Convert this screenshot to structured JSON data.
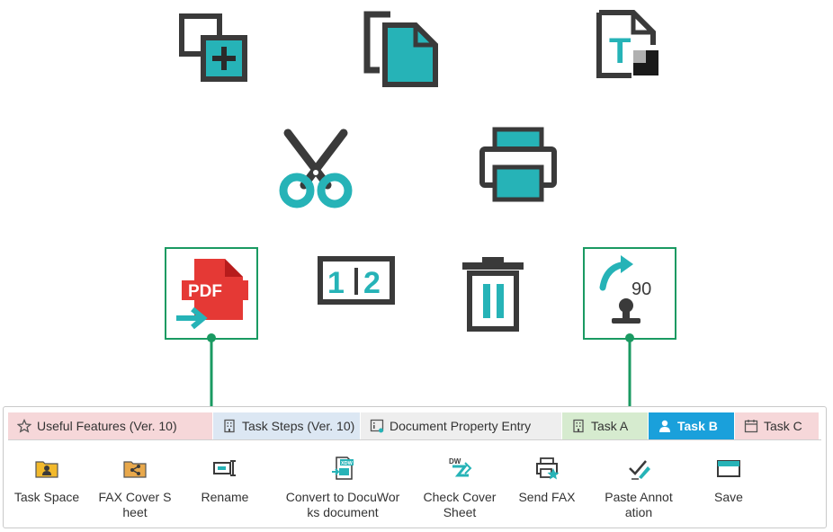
{
  "icons": [
    {
      "name": "add-frame-icon"
    },
    {
      "name": "copy-icon"
    },
    {
      "name": "text-format-icon"
    },
    {
      "name": "scissors-icon"
    },
    {
      "name": "printer-icon"
    },
    {
      "name": "pdf-convert-icon",
      "text": "PDF"
    },
    {
      "name": "split-pages-icon",
      "text1": "1",
      "text2": "2"
    },
    {
      "name": "trash-icon"
    },
    {
      "name": "rotate-stamp-icon",
      "text": "90"
    }
  ],
  "tabs": [
    {
      "label": "Useful Features (Ver. 10)"
    },
    {
      "label": "Task Steps (Ver. 10)"
    },
    {
      "label": "Document Property Entry"
    },
    {
      "label": "Task A"
    },
    {
      "label": "Task B"
    },
    {
      "label": "Task C"
    }
  ],
  "tools": [
    {
      "line1": "Task Space",
      "line2": ""
    },
    {
      "line1": "FAX Cover S",
      "line2": "heet"
    },
    {
      "line1": "Rename",
      "line2": ""
    },
    {
      "line1": "Convert to DocuWor",
      "line2": "ks document"
    },
    {
      "line1": "Check Cover",
      "line2": "Sheet"
    },
    {
      "line1": "Send FAX",
      "line2": ""
    },
    {
      "line1": "Paste Annot",
      "line2": "ation"
    },
    {
      "line1": "Save",
      "line2": ""
    }
  ],
  "colors": {
    "teal": "#26b3b7",
    "dark": "#3a3a3a",
    "green": "#1a9a62",
    "red": "#e53935",
    "active_tab": "#1aa0db"
  }
}
